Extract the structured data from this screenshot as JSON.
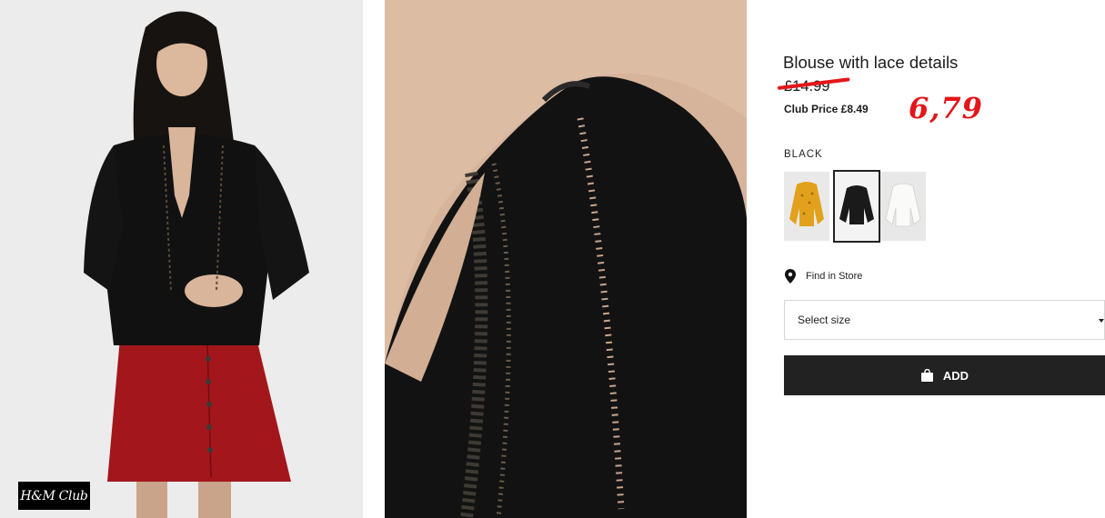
{
  "product": {
    "title": "Blouse with lace details",
    "old_price": "£14.99",
    "club_price": "Club Price £8.49",
    "handwritten_price": "6,79",
    "color_label": "BLACK",
    "swatches": [
      {
        "name": "yellow-floral",
        "color": "#e3a41e"
      },
      {
        "name": "black",
        "color": "#1a1a1a",
        "selected": true
      },
      {
        "name": "white",
        "color": "#f7f7f5"
      }
    ]
  },
  "badges": {
    "club_logo": "H&M Club"
  },
  "store": {
    "find_label": "Find in Store",
    "icon": "location-pin-icon"
  },
  "size": {
    "placeholder": "Select size",
    "icon": "caret-down-icon"
  },
  "cart": {
    "add_label": "ADD",
    "icon": "shopping-bag-icon"
  },
  "colors": {
    "accent": "#e3161b",
    "button": "#222222",
    "border": "#d6d6d6"
  }
}
